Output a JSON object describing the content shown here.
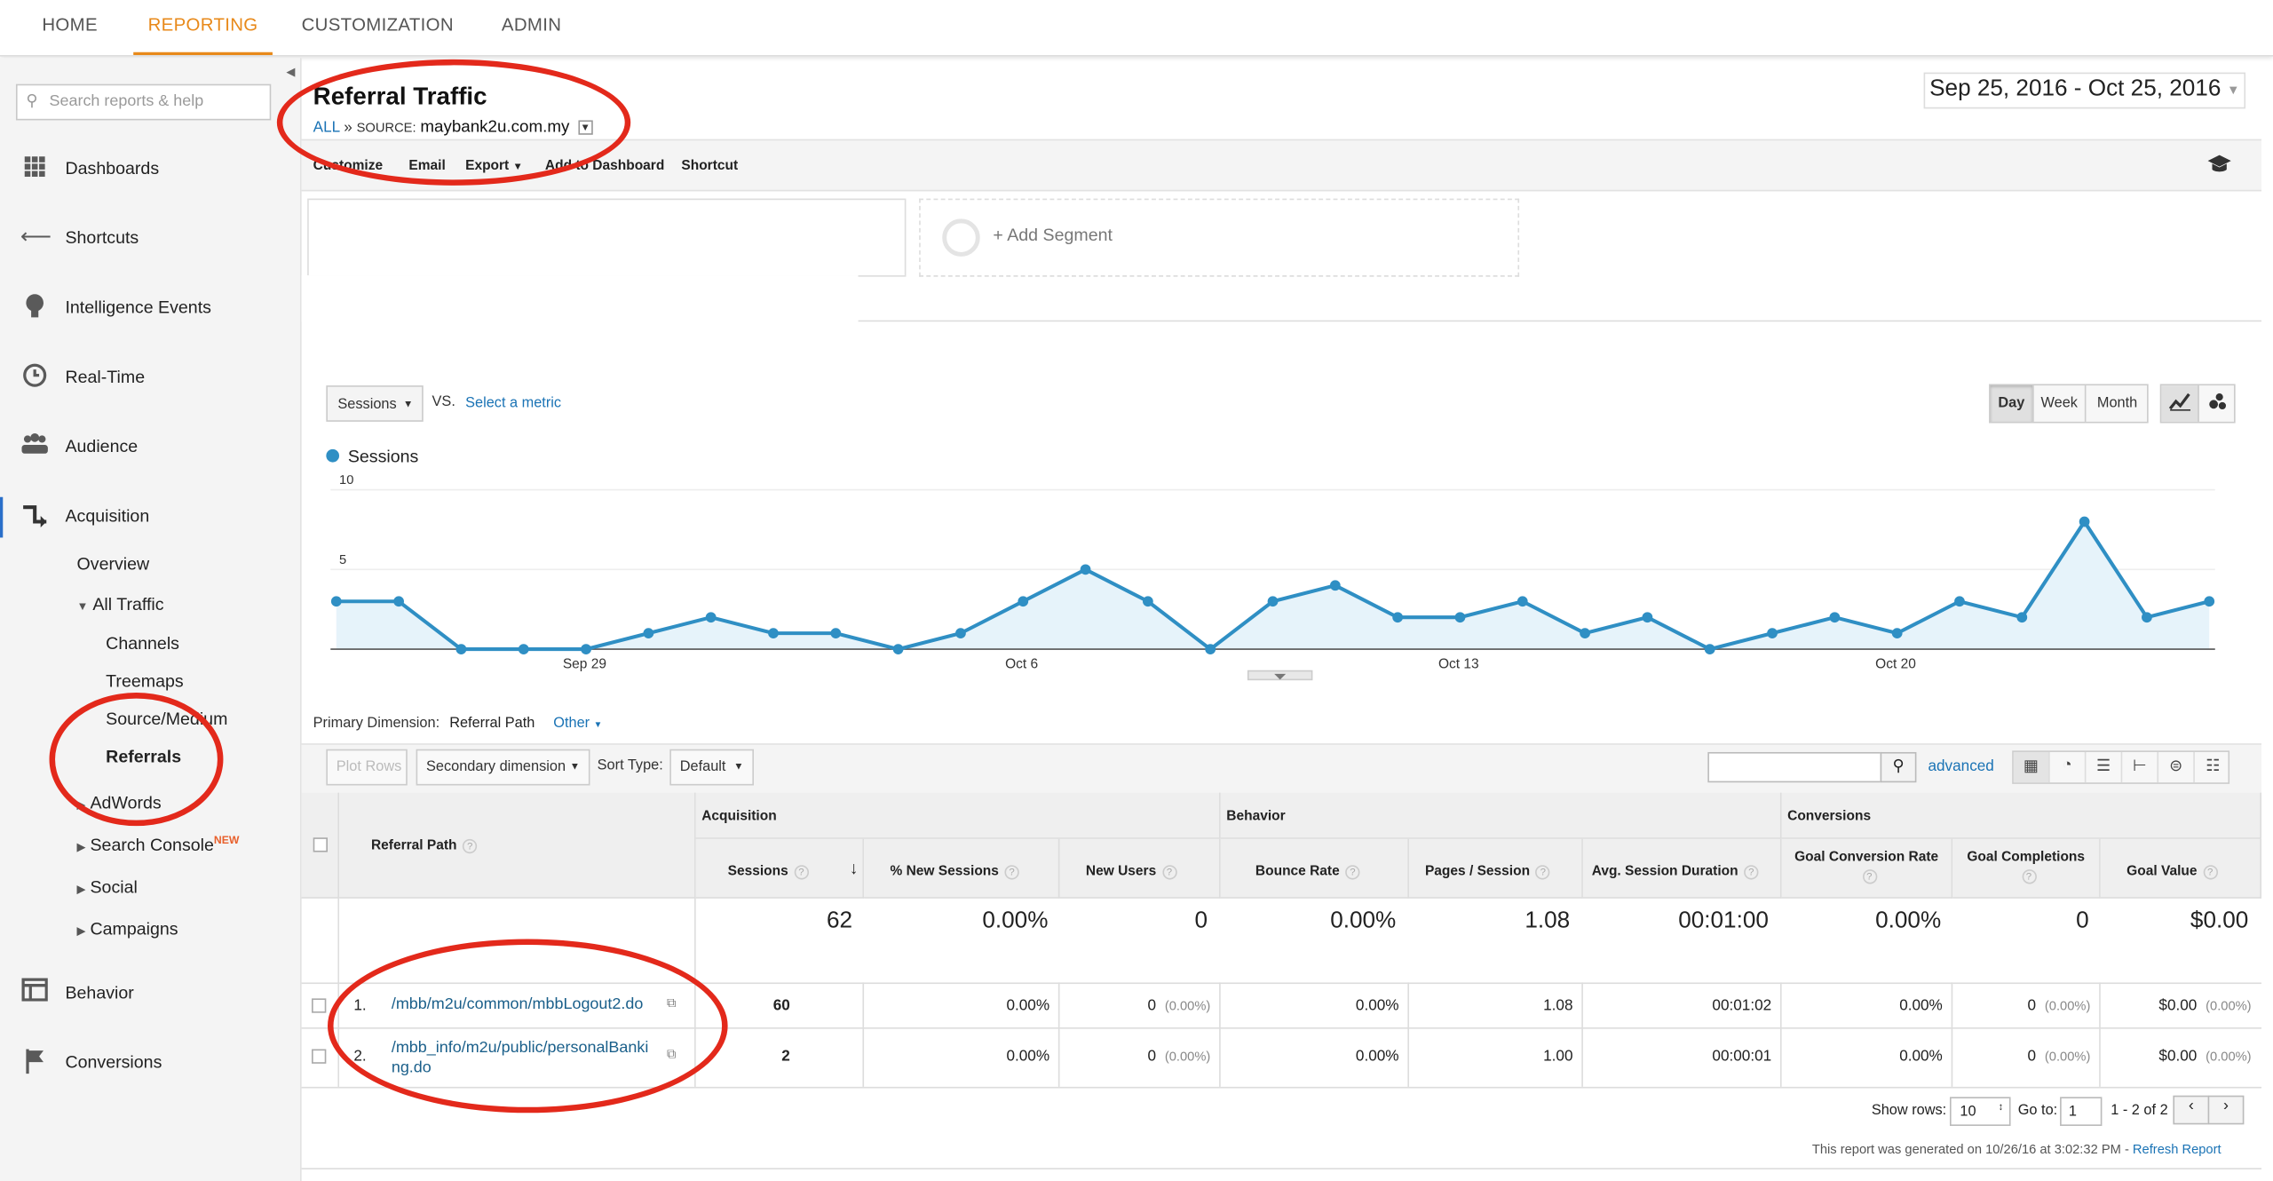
{
  "topnav": [
    "HOME",
    "REPORTING",
    "CUSTOMIZATION",
    "ADMIN"
  ],
  "search": {
    "placeholder": "Search reports & help"
  },
  "sidebar": {
    "main": [
      "Dashboards",
      "Shortcuts",
      "Intelligence Events",
      "Real-Time",
      "Audience",
      "Acquisition"
    ],
    "acq_overview": "Overview",
    "all_traffic": "All Traffic",
    "all_traffic_items": [
      "Channels",
      "Treemaps",
      "Source/Medium",
      "Referrals"
    ],
    "acq_more": [
      "AdWords",
      "Search Console",
      "Social",
      "Campaigns"
    ],
    "new_badge": "NEW",
    "bottom": [
      "Behavior",
      "Conversions"
    ]
  },
  "report": {
    "title": "Referral Traffic",
    "crumb_all": "ALL",
    "crumb_sep": "»",
    "crumb_source": "SOURCE:",
    "crumb_value": "maybank2u.com.my",
    "date_range": "Sep 25, 2016 - Oct 25, 2016"
  },
  "toolbar": [
    "Customize",
    "Email",
    "Export",
    "Add to Dashboard",
    "Shortcut"
  ],
  "segment": {
    "add": "+ Add Segment"
  },
  "chart_controls": {
    "metric": "Sessions",
    "vs": "VS.",
    "select_metric": "Select a metric",
    "periods": [
      "Day",
      "Week",
      "Month"
    ],
    "active_period": "Day"
  },
  "chart_data": {
    "type": "area",
    "series": [
      {
        "name": "Sessions",
        "values": [
          3,
          3,
          0,
          0,
          0,
          1,
          2,
          1,
          1,
          0,
          1,
          3,
          5,
          3,
          0,
          3,
          4,
          2,
          2,
          3,
          1,
          2,
          0,
          1,
          2,
          1,
          3,
          2,
          8,
          2,
          3
        ]
      }
    ],
    "x_ticks": [
      "Sep 29",
      "Oct 6",
      "Oct 13",
      "Oct 20"
    ],
    "y_ticks": [
      "10",
      "5"
    ],
    "ylim": [
      0,
      10
    ],
    "legend": "top-left",
    "colors": {
      "line": "#2f8fc4",
      "fill": "#e6f3fa"
    }
  },
  "table_controls": {
    "primary_label": "Primary Dimension:",
    "primary_value": "Referral Path",
    "other": "Other",
    "plot_rows": "Plot Rows",
    "secondary": "Secondary dimension",
    "sort_label": "Sort Type:",
    "sort_value": "Default",
    "advanced": "advanced"
  },
  "table": {
    "dim_header": "Referral Path",
    "groups": [
      "Acquisition",
      "Behavior",
      "Conversions"
    ],
    "headers": [
      "Sessions",
      "% New Sessions",
      "New Users",
      "Bounce Rate",
      "Pages / Session",
      "Avg. Session Duration",
      "Goal Conversion Rate",
      "Goal Completions",
      "Goal Value"
    ],
    "totals": [
      "62",
      "0.00%",
      "0",
      "0.00%",
      "1.08",
      "00:01:00",
      "0.00%",
      "0",
      "$0.00"
    ],
    "rows": [
      {
        "num": "1.",
        "path": "/mbb/m2u/common/mbbLogout2.do",
        "path2": "",
        "sessions": "60",
        "new_sessions": "0.00%",
        "new_users": "0",
        "new_users_pct": "(0.00%)",
        "bounce": "0.00%",
        "pages": "1.08",
        "duration": "00:01:02",
        "gcr": "0.00%",
        "gc": "0",
        "gc_pct": "(0.00%)",
        "gv": "$0.00",
        "gv_pct": "(0.00%)"
      },
      {
        "num": "2.",
        "path": "/mbb_info/m2u/public/personalBanki",
        "path2": "ng.do",
        "sessions": "2",
        "new_sessions": "0.00%",
        "new_users": "0",
        "new_users_pct": "(0.00%)",
        "bounce": "0.00%",
        "pages": "1.00",
        "duration": "00:00:01",
        "gcr": "0.00%",
        "gc": "0",
        "gc_pct": "(0.00%)",
        "gv": "$0.00",
        "gv_pct": "(0.00%)"
      }
    ]
  },
  "footer": {
    "show_rows": "Show rows:",
    "rows_value": "10",
    "goto": "Go to:",
    "goto_value": "1",
    "pager": "1 - 2 of 2",
    "generated": "This report was generated on 10/26/16 at 3:02:32 PM - ",
    "refresh": "Refresh Report"
  }
}
